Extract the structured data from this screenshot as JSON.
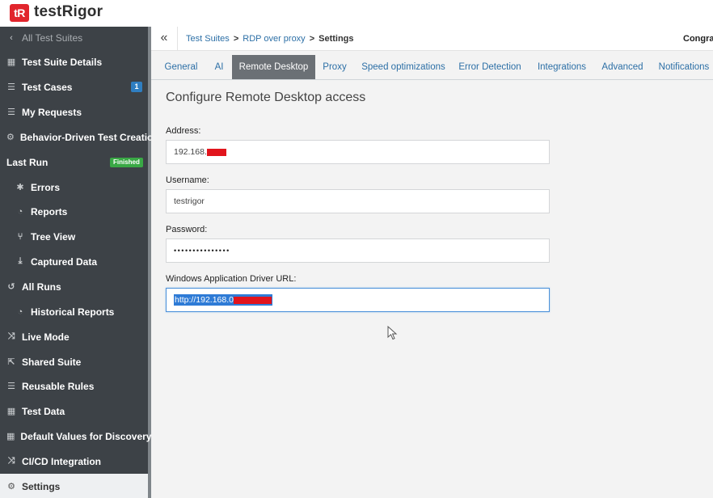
{
  "brand": {
    "logo_mark": "tR",
    "name": "testRigor"
  },
  "sidebar": {
    "back_label": "All Test Suites",
    "items": [
      {
        "label": "Test Suite Details",
        "icon": "table-icon"
      },
      {
        "label": "Test Cases",
        "icon": "list-icon",
        "badge": "1"
      },
      {
        "label": "My Requests",
        "icon": "list-icon"
      },
      {
        "label": "Behavior-Driven Test Creation",
        "icon": "robot-icon"
      },
      {
        "label": "Last Run",
        "status": "Finished"
      },
      {
        "label": "Errors",
        "icon": "bug-icon"
      },
      {
        "label": "Reports",
        "icon": "pie-icon"
      },
      {
        "label": "Tree View",
        "icon": "tree-icon"
      },
      {
        "label": "Captured Data",
        "icon": "download-icon"
      },
      {
        "label": "All Runs",
        "icon": "history-icon"
      },
      {
        "label": "Historical Reports",
        "icon": "pie-icon"
      },
      {
        "label": "Live Mode",
        "icon": "shuffle-icon"
      },
      {
        "label": "Shared Suite",
        "icon": "share-icon"
      },
      {
        "label": "Reusable Rules",
        "icon": "list-icon"
      },
      {
        "label": "Test Data",
        "icon": "table-icon"
      },
      {
        "label": "Default Values for Discovery",
        "icon": "table-icon"
      },
      {
        "label": "CI/CD Integration",
        "icon": "shuffle-icon"
      },
      {
        "label": "Settings",
        "icon": "gears-icon",
        "active": true
      }
    ]
  },
  "breadcrumb": {
    "items": [
      "Test Suites",
      "RDP over proxy"
    ],
    "current": "Settings"
  },
  "header_notice": "Congrat",
  "tabs": [
    {
      "label": "General"
    },
    {
      "label": "AI"
    },
    {
      "label": "Remote Desktop",
      "active": true
    },
    {
      "label": "Proxy"
    },
    {
      "label": "Speed optimizations"
    },
    {
      "label": "Error Detection"
    },
    {
      "label": "Integrations"
    },
    {
      "label": "Advanced"
    },
    {
      "label": "Notifications"
    }
  ],
  "form": {
    "title": "Configure Remote Desktop access",
    "address": {
      "label": "Address:",
      "value": "192.168."
    },
    "username": {
      "label": "Username:",
      "value": "testrigor"
    },
    "password": {
      "label": "Password:",
      "value": "•••••••••••••••"
    },
    "winapp": {
      "label": "Windows Application Driver URL:",
      "value": "http://192.168.0"
    }
  },
  "colors": {
    "accent": "#2c6fa6",
    "sidebar_bg": "#3d4247",
    "brand_red": "#e1252c",
    "finished_green": "#39a845"
  }
}
